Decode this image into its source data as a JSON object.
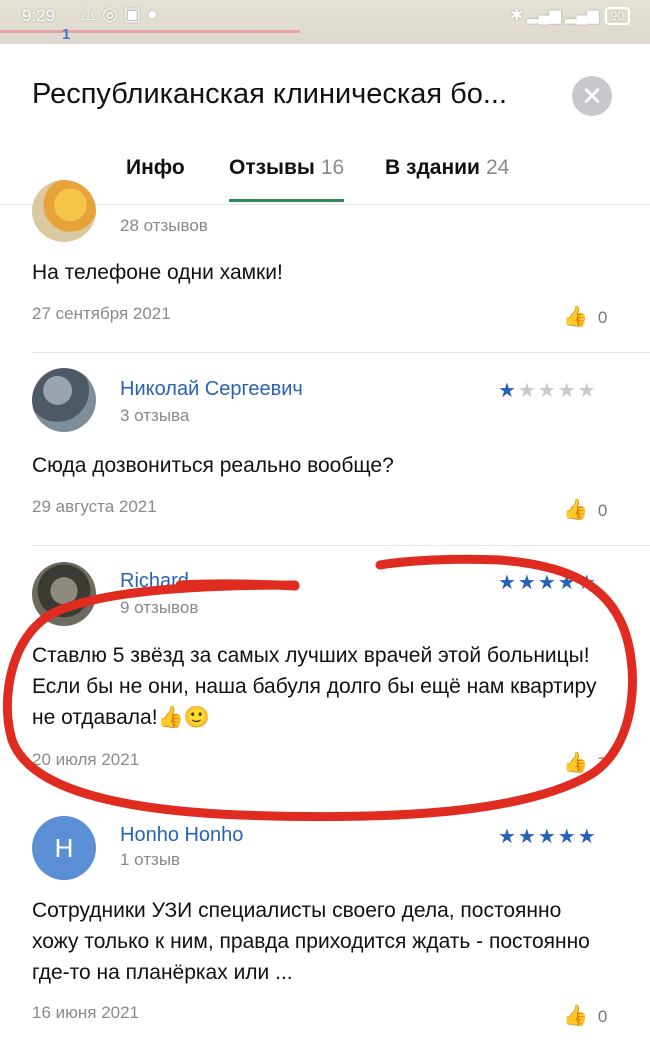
{
  "status_bar": {
    "time": "9:29",
    "battery": "90"
  },
  "header": {
    "title": "Республиканская клиническая бо...",
    "close_icon": "close-icon"
  },
  "tabs": [
    {
      "label": "Инфо",
      "count": ""
    },
    {
      "label": "Отзывы",
      "count": "16",
      "active": true
    },
    {
      "label": "В здании",
      "count": "24"
    }
  ],
  "reviews": [
    {
      "author": "",
      "reviews_count": "28 отзывов",
      "text": "На телефоне одни хамки!",
      "date": "27 сентября 2021",
      "likes": "0"
    },
    {
      "author": "Николай Сергеевич",
      "reviews_count": "3 отзыва",
      "stars": 1,
      "text": "Сюда дозвониться реально вообще?",
      "date": "29 августа 2021",
      "likes": "0"
    },
    {
      "author": "Richard",
      "reviews_count": "9 отзывов",
      "stars": 5,
      "text": "Ставлю 5 звёзд за самых лучших врачей этой больницы! Если бы не они, наша бабуля долго бы ещё нам квартиру не отдавала!👍🙂",
      "date": "20 июля 2021",
      "likes": "7"
    },
    {
      "author": "Honho Honho",
      "avatar_letter": "H",
      "reviews_count": "1 отзыв",
      "stars": 5,
      "text": "Сотрудники УЗИ специалисты своего дела, постоянно хожу только к ним, правда приходится ждать - постоянно где-то на планёрках или ...",
      "date": "16 июня 2021",
      "likes": "0"
    }
  ],
  "colors": {
    "accent_tab": "#2e8b57",
    "author_link": "#2862b7",
    "annotation": "#e02b20"
  }
}
